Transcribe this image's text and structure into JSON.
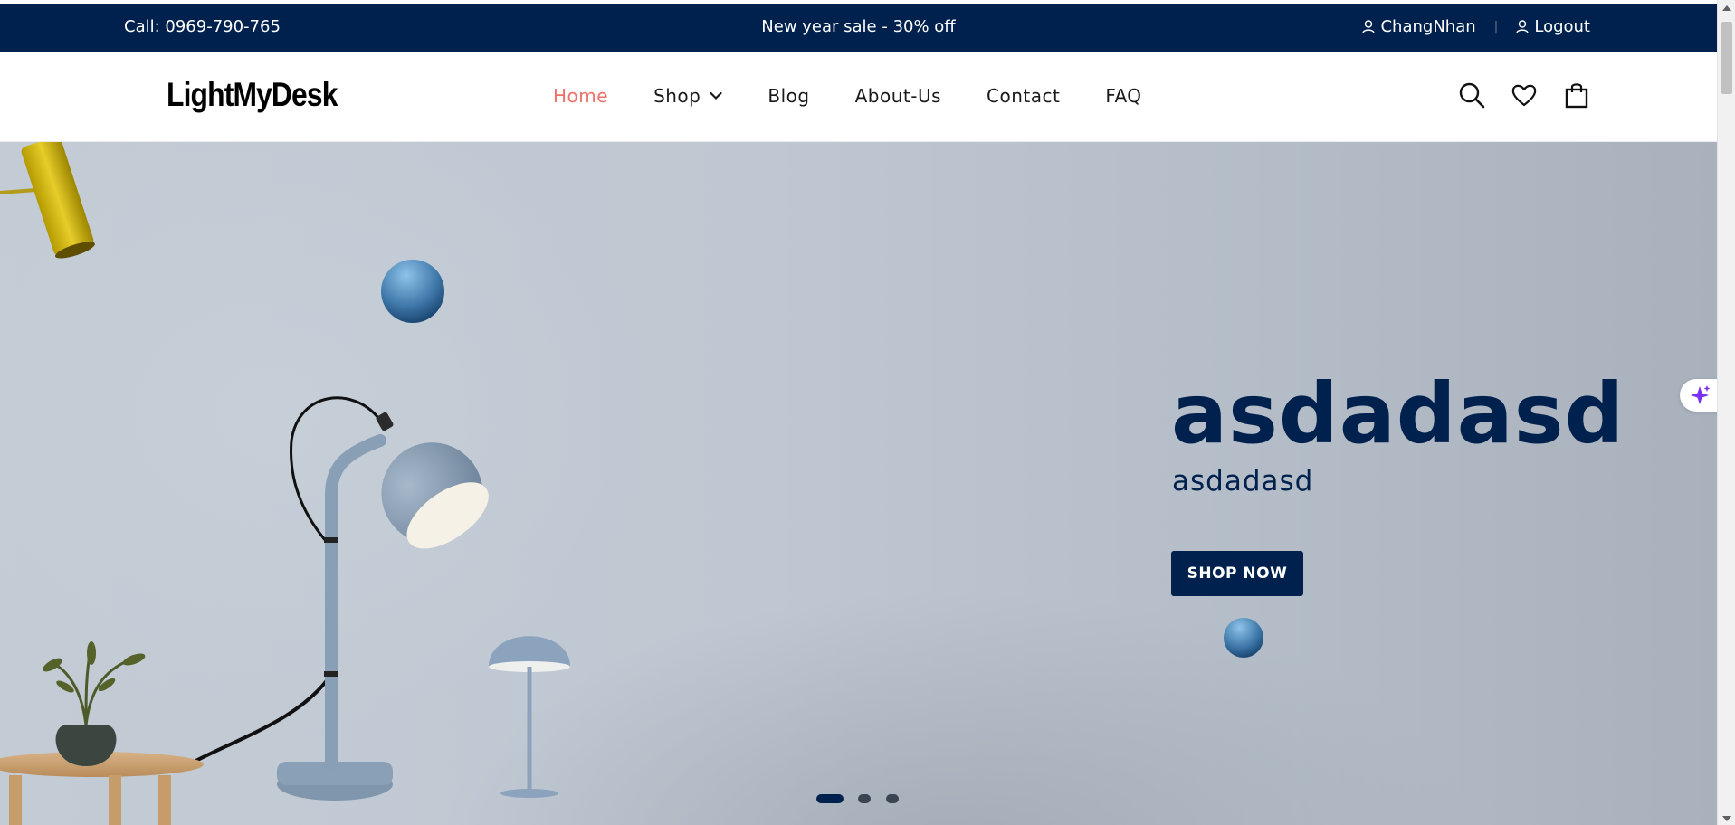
{
  "topbar": {
    "call": "Call: 0969-790-765",
    "promo": "New year sale - 30% off",
    "username": "ChangNhan",
    "logout": "Logout"
  },
  "header": {
    "logo": "LightMyDesk",
    "nav": [
      {
        "label": "Home",
        "active": true
      },
      {
        "label": "Shop",
        "has_dropdown": true
      },
      {
        "label": "Blog"
      },
      {
        "label": "About-Us"
      },
      {
        "label": "Contact"
      },
      {
        "label": "FAQ"
      }
    ],
    "icons": [
      "search-icon",
      "heart-icon",
      "shopping-bag-icon"
    ]
  },
  "hero": {
    "title": "asdadasd",
    "subtitle": "asdadasd",
    "cta_label": "SHOP NOW",
    "slides": 3,
    "active_slide": 1
  },
  "colors": {
    "navy": "#00214d",
    "active_nav": "#f0706a",
    "hero_bg": "#bfc7d2"
  }
}
